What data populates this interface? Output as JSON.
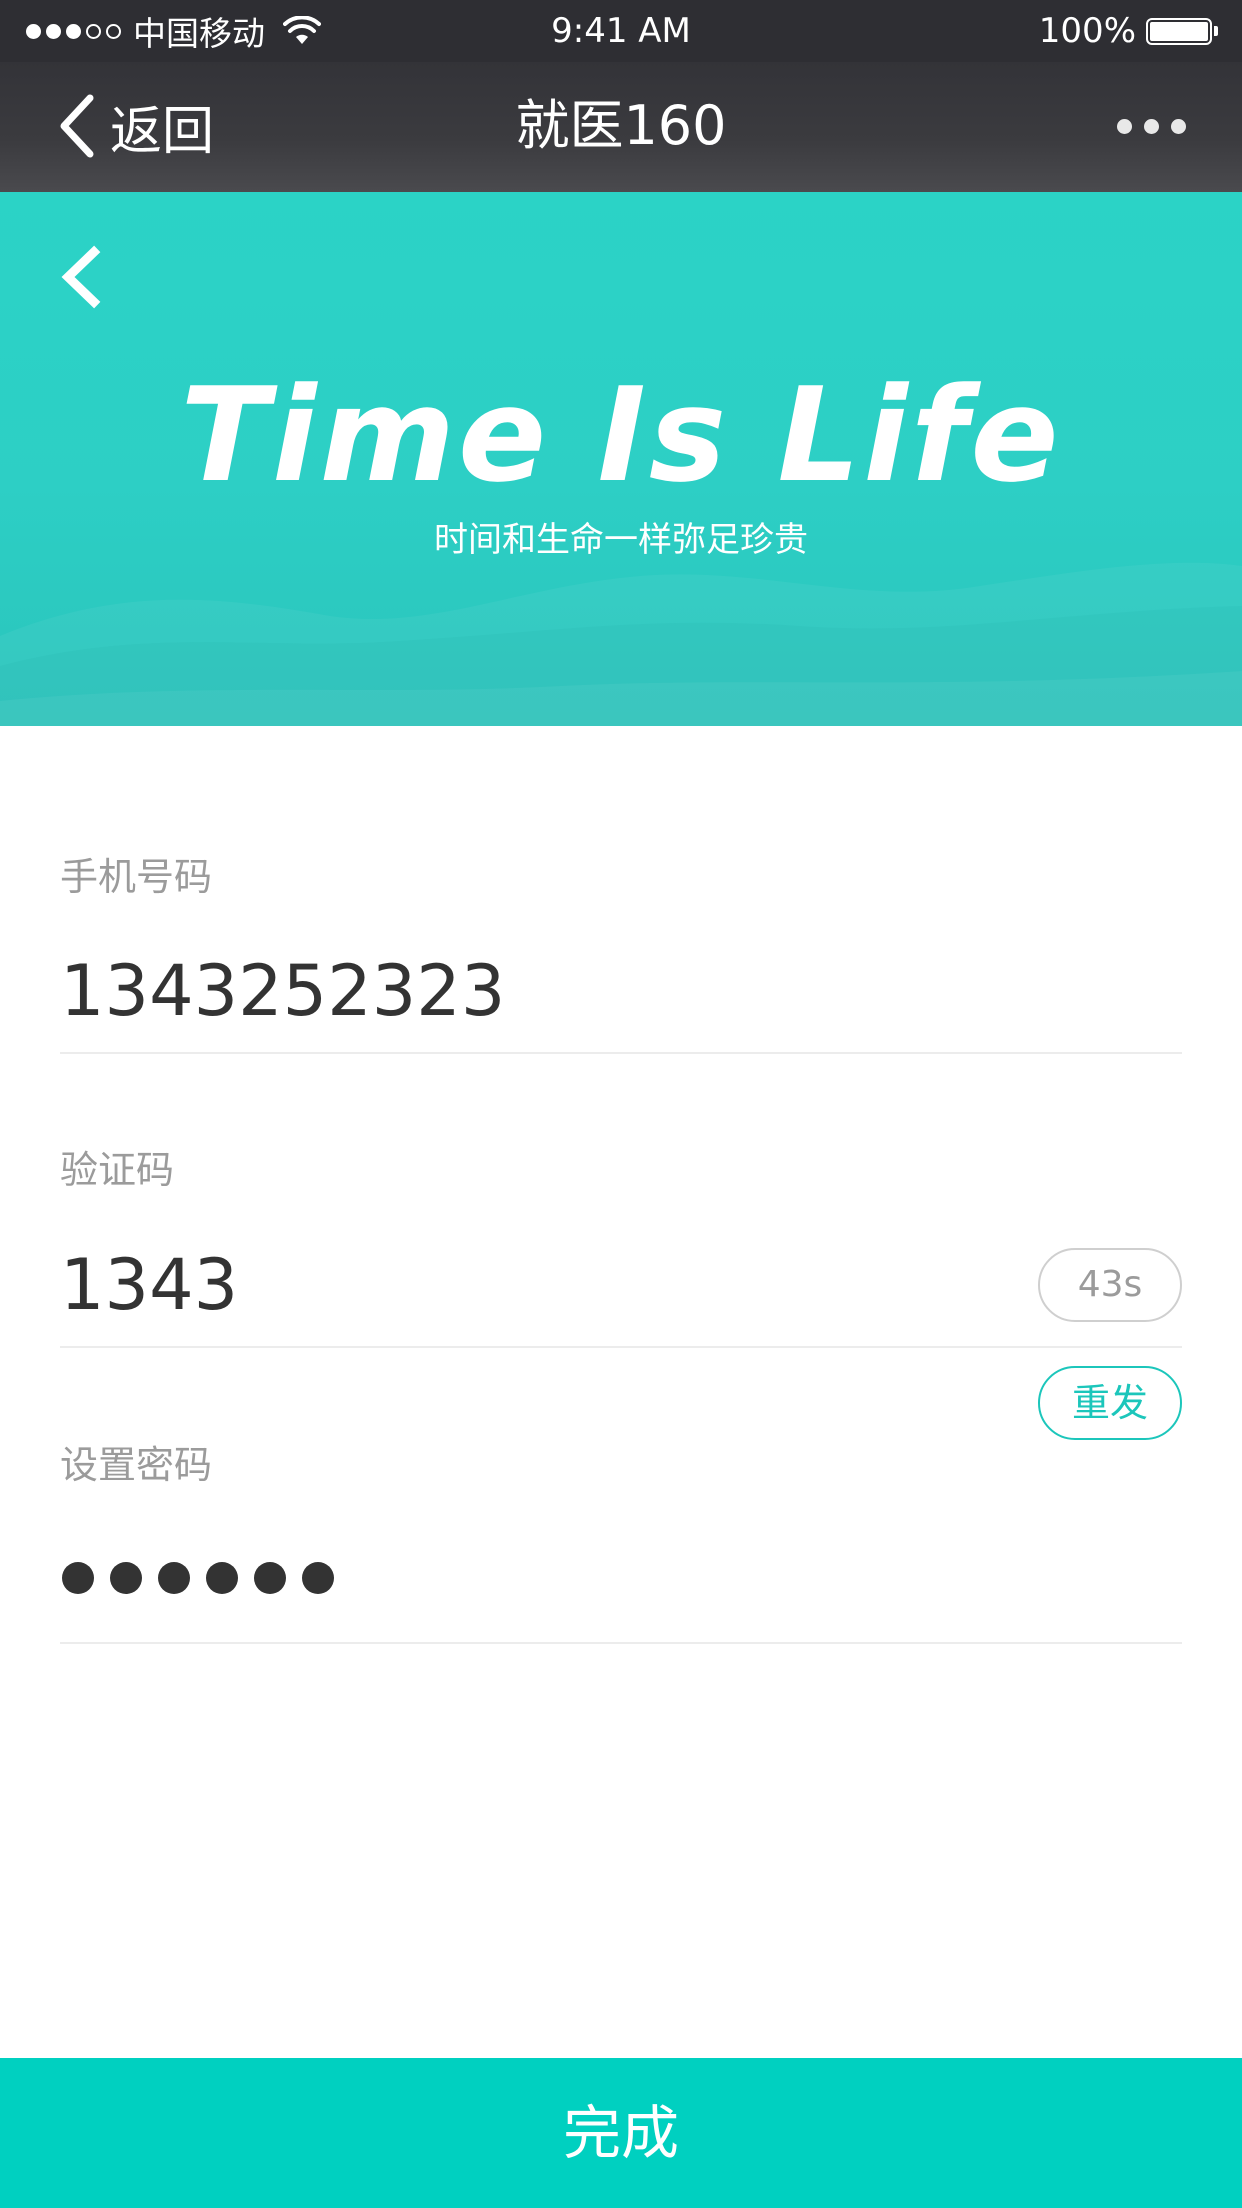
{
  "status_bar": {
    "signal_dots": [
      true,
      true,
      true,
      false,
      false
    ],
    "carrier": "中国移动",
    "time": "9:41 AM",
    "battery_percent": "100%",
    "battery_level": 1.0
  },
  "nav": {
    "back_label": "返回",
    "title": "就医160",
    "more_icon": "more-dots-icon"
  },
  "banner": {
    "slogan": "Time Is Life",
    "subtitle": "时间和生命一样弥足珍贵",
    "background_color": "#2dcfc5"
  },
  "form": {
    "phone": {
      "label": "手机号码",
      "value": "1343252323"
    },
    "code": {
      "label": "验证码",
      "value": "1343",
      "countdown": "43s",
      "resend_label": "重发"
    },
    "password": {
      "label": "设置密码",
      "masked_length": 6
    }
  },
  "submit": {
    "label": "完成",
    "color": "#00d0c0"
  },
  "colors": {
    "accent": "#1cc6bb",
    "nav_bg": "#333338"
  }
}
